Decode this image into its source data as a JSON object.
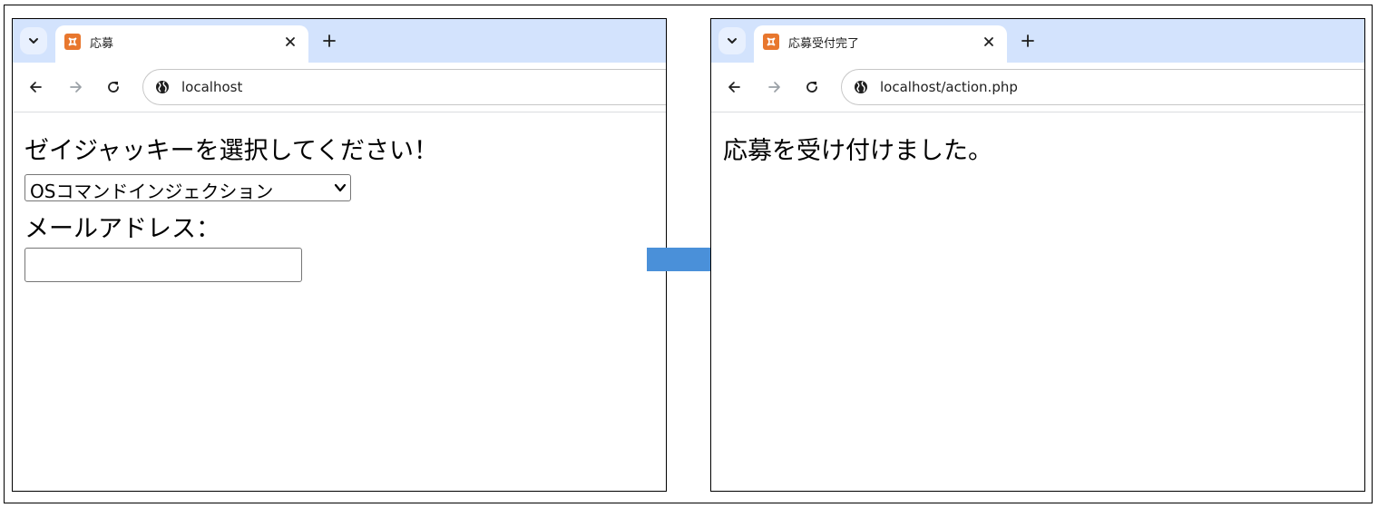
{
  "left_window": {
    "tab": {
      "title": "応募"
    },
    "url": "localhost",
    "heading": "ゼイジャッキーを選択してください！",
    "select": {
      "selected": "OSコマンドインジェクション"
    },
    "email_label": "メールアドレス：",
    "email_input": {
      "value": "",
      "placeholder": ""
    }
  },
  "right_window": {
    "tab": {
      "title": "応募受付完了"
    },
    "url": "localhost/action.php",
    "message": "応募を受け付けました。"
  },
  "icons": {
    "tab_search": "chevron-down-icon",
    "favicon": "xampp-favicon-icon",
    "close": "close-icon",
    "new_tab": "plus-icon",
    "back": "arrow-left-icon",
    "forward": "arrow-right-icon",
    "reload": "reload-icon",
    "site_info": "globe-icon",
    "flow_arrow": "right-arrow-icon"
  },
  "colors": {
    "tabstrip": "#d3e3fd",
    "favicon": "#e8772e",
    "flow_arrow": "#4a90d9"
  }
}
